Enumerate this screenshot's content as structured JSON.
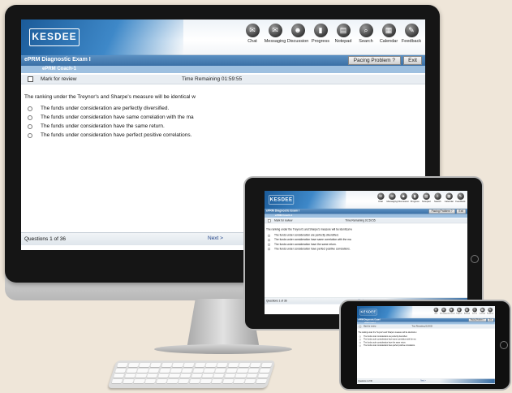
{
  "app": {
    "logo_text": "KESDEE",
    "brand_color": "#2c6faf",
    "toolbar": [
      {
        "label": "Chat",
        "icon": "chat-icon",
        "glyph": "✉"
      },
      {
        "label": "Messaging",
        "icon": "messaging-icon",
        "glyph": "✉"
      },
      {
        "label": "Discussion",
        "icon": "discussion-icon",
        "glyph": "☻"
      },
      {
        "label": "Progress",
        "icon": "progress-icon",
        "glyph": "▮"
      },
      {
        "label": "Notepad",
        "icon": "notepad-icon",
        "glyph": "▤"
      },
      {
        "label": "Search",
        "icon": "search-icon",
        "glyph": "⌕"
      },
      {
        "label": "Calendar",
        "icon": "calendar-icon",
        "glyph": "▦"
      },
      {
        "label": "Feedback",
        "icon": "feedback-icon",
        "glyph": "✎"
      }
    ],
    "exam_title": "ePRM Diagnostic Exam I",
    "pacing_button": "Pacing Problem ?",
    "exit_button": "Exit",
    "section_label": "ePRM Coach-1",
    "mark_for_review": "Mark for review",
    "timer": "Time Remaining 01:59:55",
    "question": "The ranking under the Treynor's and Sharpe's measure will be identical w",
    "options": [
      "The funds under consideration are perfectly diversified.",
      "The funds under consideration have same correlation with the ma",
      "The funds under consideration have the same return.",
      "The funds under consideration have perfect positive correlations."
    ],
    "question_count": "Questions 1 of 36",
    "next_button": "Next >"
  }
}
